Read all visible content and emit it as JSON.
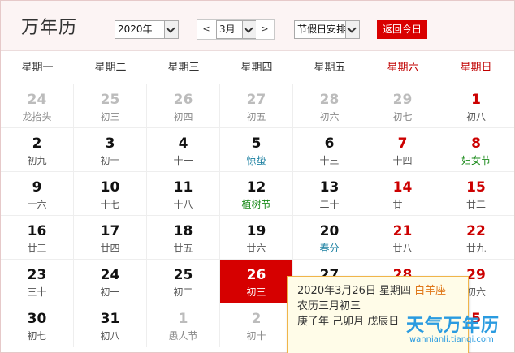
{
  "header": {
    "title": "万年历",
    "year_value": "2020年",
    "prev_label": "<",
    "month_value": "3月",
    "next_label": ">",
    "holiday_value": "节假日安排",
    "today_button": "返回今日"
  },
  "weekdays": [
    "星期一",
    "星期二",
    "星期三",
    "星期四",
    "星期五",
    "星期六",
    "星期日"
  ],
  "weeks": [
    [
      {
        "day": "24",
        "sub": "龙抬头",
        "state": "other"
      },
      {
        "day": "25",
        "sub": "初三",
        "state": "other"
      },
      {
        "day": "26",
        "sub": "初四",
        "state": "other"
      },
      {
        "day": "27",
        "sub": "初五",
        "state": "other"
      },
      {
        "day": "28",
        "sub": "初六",
        "state": "other"
      },
      {
        "day": "29",
        "sub": "初七",
        "state": "other"
      },
      {
        "day": "1",
        "sub": "初八",
        "state": "weekend"
      }
    ],
    [
      {
        "day": "2",
        "sub": "初九",
        "state": ""
      },
      {
        "day": "3",
        "sub": "初十",
        "state": ""
      },
      {
        "day": "4",
        "sub": "十一",
        "state": ""
      },
      {
        "day": "5",
        "sub": "惊蛰",
        "state": "",
        "sub_type": "term"
      },
      {
        "day": "6",
        "sub": "十三",
        "state": ""
      },
      {
        "day": "7",
        "sub": "十四",
        "state": "weekend"
      },
      {
        "day": "8",
        "sub": "妇女节",
        "state": "weekend",
        "sub_type": "fest"
      }
    ],
    [
      {
        "day": "9",
        "sub": "十六",
        "state": ""
      },
      {
        "day": "10",
        "sub": "十七",
        "state": ""
      },
      {
        "day": "11",
        "sub": "十八",
        "state": ""
      },
      {
        "day": "12",
        "sub": "植树节",
        "state": "",
        "sub_type": "fest"
      },
      {
        "day": "13",
        "sub": "二十",
        "state": ""
      },
      {
        "day": "14",
        "sub": "廿一",
        "state": "weekend"
      },
      {
        "day": "15",
        "sub": "廿二",
        "state": "weekend"
      }
    ],
    [
      {
        "day": "16",
        "sub": "廿三",
        "state": ""
      },
      {
        "day": "17",
        "sub": "廿四",
        "state": ""
      },
      {
        "day": "18",
        "sub": "廿五",
        "state": ""
      },
      {
        "day": "19",
        "sub": "廿六",
        "state": ""
      },
      {
        "day": "20",
        "sub": "春分",
        "state": "",
        "sub_type": "term"
      },
      {
        "day": "21",
        "sub": "廿八",
        "state": "weekend"
      },
      {
        "day": "22",
        "sub": "廿九",
        "state": "weekend"
      }
    ],
    [
      {
        "day": "23",
        "sub": "三十",
        "state": ""
      },
      {
        "day": "24",
        "sub": "初一",
        "state": ""
      },
      {
        "day": "25",
        "sub": "初二",
        "state": ""
      },
      {
        "day": "26",
        "sub": "初三",
        "state": "today"
      },
      {
        "day": "27",
        "sub": "",
        "state": ""
      },
      {
        "day": "28",
        "sub": "",
        "state": "weekend"
      },
      {
        "day": "29",
        "sub": "初六",
        "state": "weekend"
      }
    ],
    [
      {
        "day": "30",
        "sub": "初七",
        "state": ""
      },
      {
        "day": "31",
        "sub": "初八",
        "state": ""
      },
      {
        "day": "1",
        "sub": "愚人节",
        "state": "other"
      },
      {
        "day": "2",
        "sub": "初十",
        "state": "other"
      },
      {
        "day": "",
        "sub": "",
        "state": "other"
      },
      {
        "day": "",
        "sub": "",
        "state": "other"
      },
      {
        "day": "5",
        "sub": "",
        "state": "weekend"
      }
    ]
  ],
  "popup": {
    "date_line": "2020年3月26日 星期四",
    "constellation": "白羊座",
    "lunar_line": "农历三月初三",
    "ganzhi_line": "庚子年 己卯月 戊辰日"
  },
  "watermark": {
    "text": "天气万年历",
    "url": "wannianli.tianqi.com"
  },
  "colors": {
    "accent": "#d90000",
    "weekend": "#cc0000",
    "solar_term": "#1a7fa0",
    "festival": "#1a8a1a"
  }
}
